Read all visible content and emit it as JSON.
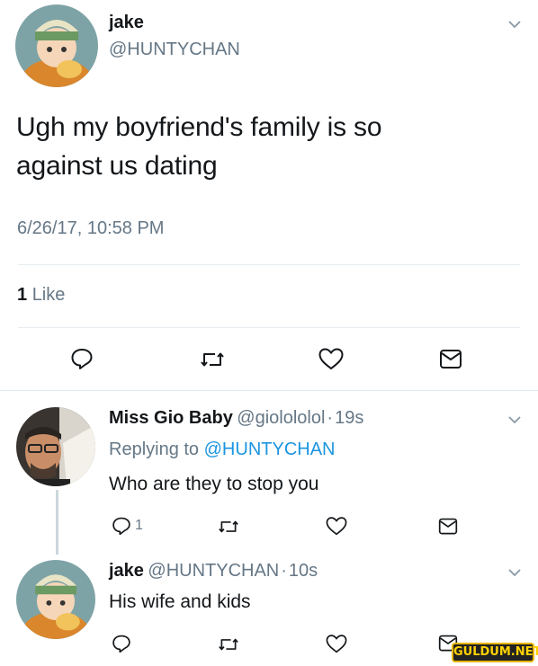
{
  "main_tweet": {
    "name": "jake",
    "handle": "@HUNTYCHAN",
    "text_line1": "Ugh my boyfriend's family is so",
    "text_line2": "against us dating",
    "timestamp": "6/26/17, 10:58 PM",
    "likes_count": "1",
    "likes_label": "Like"
  },
  "replies": [
    {
      "name": "Miss Gio Baby",
      "handle": "@giolololol",
      "separator": "·",
      "time": "19s",
      "replying_prefix": "Replying to",
      "replying_handle": "@HUNTYCHAN",
      "text": "Who are they to stop you",
      "reply_count": "1"
    },
    {
      "name": "jake",
      "handle": "@HUNTYCHAN",
      "separator": "·",
      "time": "10s",
      "text": "His wife and kids"
    }
  ],
  "watermark": "GULDUM.NET",
  "colors": {
    "accent": "#1b95e0",
    "muted": "#657786",
    "text": "#14171a",
    "divider": "#e6ecf0"
  }
}
